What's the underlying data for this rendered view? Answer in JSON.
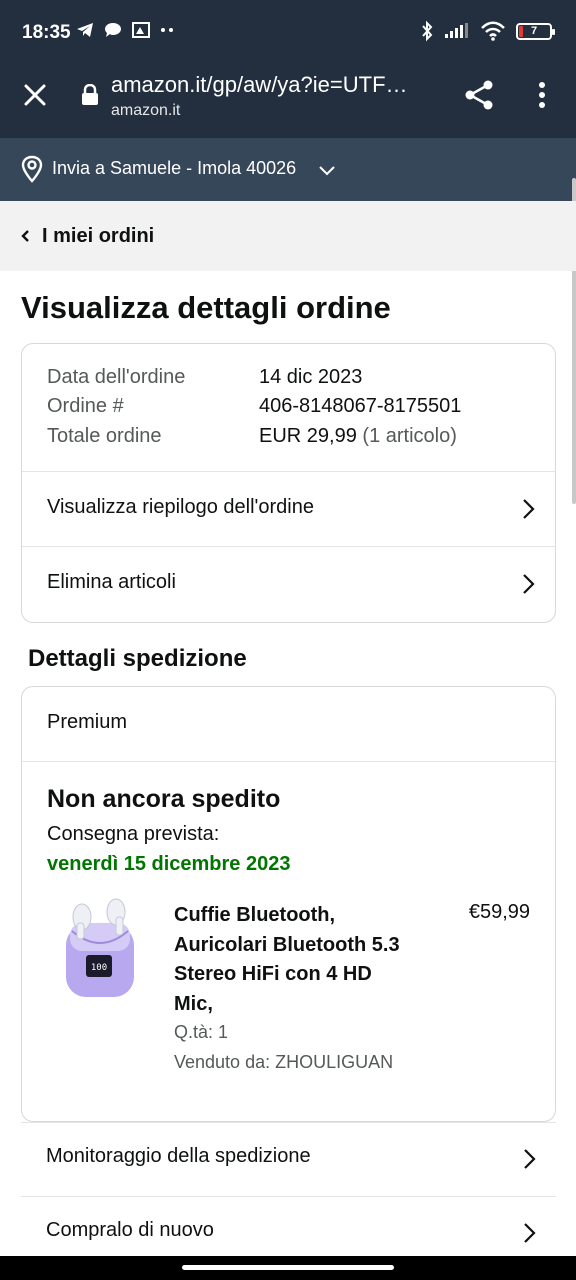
{
  "status_bar": {
    "time": "18:35",
    "battery": "7",
    "icons_left": [
      "telegram-icon",
      "chat-icon",
      "gallery-icon",
      "more-dots-icon"
    ],
    "icons_right": [
      "bluetooth-icon",
      "signal-icon",
      "wifi-icon",
      "battery-icon"
    ]
  },
  "browser": {
    "url": "amazon.it/gp/aw/ya?ie=UTF…",
    "domain": "amazon.it"
  },
  "delivery_bar": {
    "text": "Invia a Samuele - Imola 40026"
  },
  "back": {
    "label": "I miei ordini"
  },
  "page_title": "Visualizza dettagli ordine",
  "order_info": {
    "date_label": "Data dell'ordine",
    "date_value": "14 dic 2023",
    "number_label": "Ordine #",
    "number_value": "406-8148067-8175501",
    "total_label": "Totale ordine",
    "total_value": "EUR 29,99",
    "total_items": "(1 articolo)"
  },
  "order_links": {
    "summary": "Visualizza riepilogo dell'ordine",
    "delete": "Elimina articoli"
  },
  "shipping": {
    "section_title": "Dettagli spedizione",
    "method": "Premium",
    "status": "Non ancora spedito",
    "delivery_label": "Consegna prevista:",
    "delivery_date": "venerdì 15 dicembre 2023"
  },
  "product": {
    "name": "Cuffie Bluetooth, Auricolari Bluetooth 5.3 Stereo HiFi con 4 HD Mic,",
    "price": "€59,99",
    "quantity": "Q.tà: 1",
    "seller": "Venduto da: ZHOULIGUAN"
  },
  "actions": {
    "track": "Monitoraggio della spedizione",
    "buy_again": "Compralo di nuovo"
  },
  "colors": {
    "header_bg": "#232f3e",
    "delivery_bar_bg": "#37475a",
    "delivery_date": "#007600"
  }
}
